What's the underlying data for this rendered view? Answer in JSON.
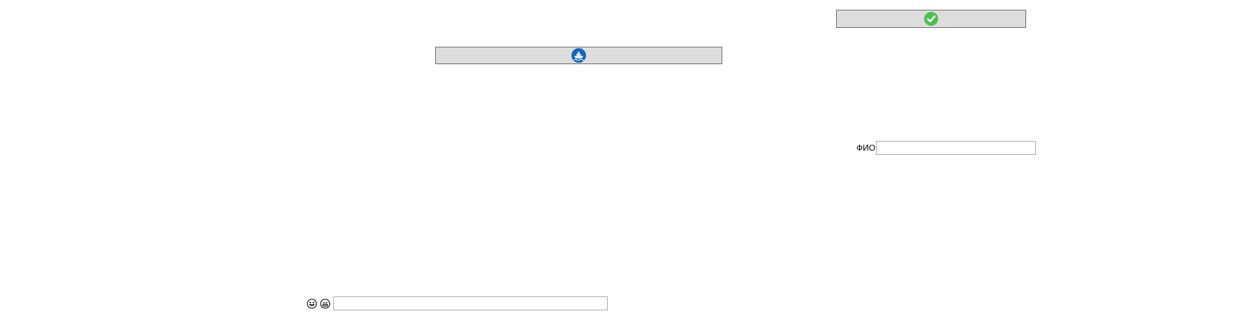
{
  "buttons": {
    "confirm": {
      "icon": "green-check-circle-icon",
      "color": "#4cc04f"
    },
    "ship": {
      "icon": "blue-ship-circle-icon",
      "color": "#1565c0"
    }
  },
  "fio_field": {
    "label": "ФИО",
    "value": "",
    "placeholder": ""
  },
  "bottom_field": {
    "icons": [
      "smiley-face-icon",
      "grinning-face-icon"
    ],
    "value": "",
    "placeholder": ""
  },
  "colors": {
    "button_bg": "#dddddd",
    "button_border": "#6b6b6b",
    "input_border": "#a9a9a9"
  }
}
